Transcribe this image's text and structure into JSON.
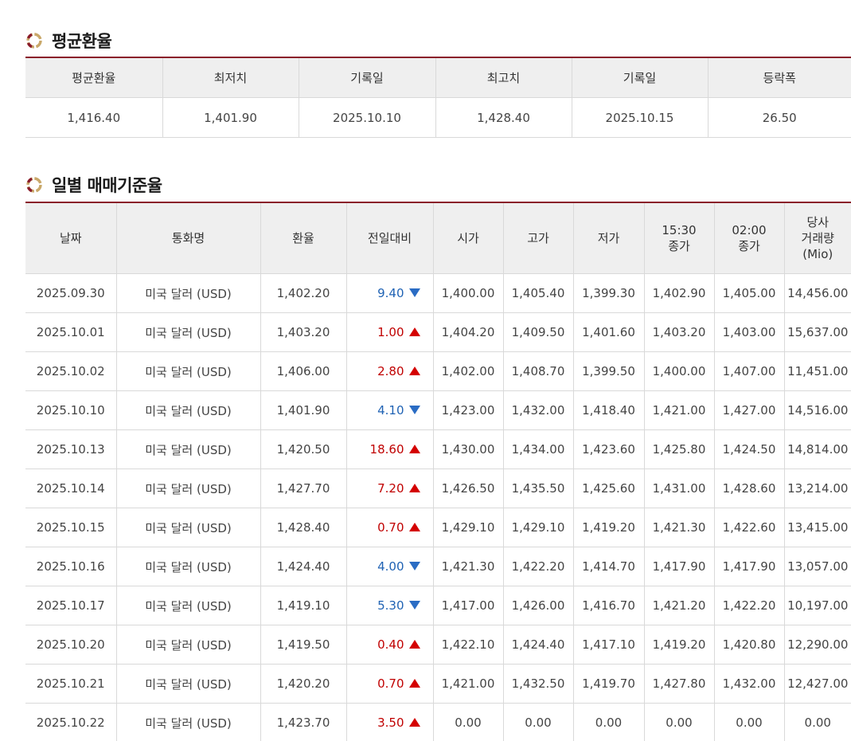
{
  "avg_section": {
    "title": "평균환율",
    "headers": [
      "평균환율",
      "최저치",
      "기록일",
      "최고치",
      "기록일",
      "등락폭"
    ],
    "values": [
      "1,416.40",
      "1,401.90",
      "2025.10.10",
      "1,428.40",
      "2025.10.15",
      "26.50"
    ]
  },
  "daily_section": {
    "title": "일별 매매기준율",
    "headers": [
      "날짜",
      "통화명",
      "환율",
      "전일대비",
      "시가",
      "고가",
      "저가",
      "15:30\n종가",
      "02:00\n종가",
      "당사\n거래량\n(Mio)"
    ],
    "rows": [
      {
        "date": "2025.09.30",
        "currency": "미국 달러 (USD)",
        "rate": "1,402.20",
        "change": "9.40",
        "dir": "down",
        "open": "1,400.00",
        "high": "1,405.40",
        "low": "1,399.30",
        "close1530": "1,402.90",
        "close0200": "1,405.00",
        "volume": "14,456.00"
      },
      {
        "date": "2025.10.01",
        "currency": "미국 달러 (USD)",
        "rate": "1,403.20",
        "change": "1.00",
        "dir": "up",
        "open": "1,404.20",
        "high": "1,409.50",
        "low": "1,401.60",
        "close1530": "1,403.20",
        "close0200": "1,403.00",
        "volume": "15,637.00"
      },
      {
        "date": "2025.10.02",
        "currency": "미국 달러 (USD)",
        "rate": "1,406.00",
        "change": "2.80",
        "dir": "up",
        "open": "1,402.00",
        "high": "1,408.70",
        "low": "1,399.50",
        "close1530": "1,400.00",
        "close0200": "1,407.00",
        "volume": "11,451.00"
      },
      {
        "date": "2025.10.10",
        "currency": "미국 달러 (USD)",
        "rate": "1,401.90",
        "change": "4.10",
        "dir": "down",
        "open": "1,423.00",
        "high": "1,432.00",
        "low": "1,418.40",
        "close1530": "1,421.00",
        "close0200": "1,427.00",
        "volume": "14,516.00"
      },
      {
        "date": "2025.10.13",
        "currency": "미국 달러 (USD)",
        "rate": "1,420.50",
        "change": "18.60",
        "dir": "up",
        "open": "1,430.00",
        "high": "1,434.00",
        "low": "1,423.60",
        "close1530": "1,425.80",
        "close0200": "1,424.50",
        "volume": "14,814.00"
      },
      {
        "date": "2025.10.14",
        "currency": "미국 달러 (USD)",
        "rate": "1,427.70",
        "change": "7.20",
        "dir": "up",
        "open": "1,426.50",
        "high": "1,435.50",
        "low": "1,425.60",
        "close1530": "1,431.00",
        "close0200": "1,428.60",
        "volume": "13,214.00"
      },
      {
        "date": "2025.10.15",
        "currency": "미국 달러 (USD)",
        "rate": "1,428.40",
        "change": "0.70",
        "dir": "up",
        "open": "1,429.10",
        "high": "1,429.10",
        "low": "1,419.20",
        "close1530": "1,421.30",
        "close0200": "1,422.60",
        "volume": "13,415.00"
      },
      {
        "date": "2025.10.16",
        "currency": "미국 달러 (USD)",
        "rate": "1,424.40",
        "change": "4.00",
        "dir": "down",
        "open": "1,421.30",
        "high": "1,422.20",
        "low": "1,414.70",
        "close1530": "1,417.90",
        "close0200": "1,417.90",
        "volume": "13,057.00"
      },
      {
        "date": "2025.10.17",
        "currency": "미국 달러 (USD)",
        "rate": "1,419.10",
        "change": "5.30",
        "dir": "down",
        "open": "1,417.00",
        "high": "1,426.00",
        "low": "1,416.70",
        "close1530": "1,421.20",
        "close0200": "1,422.20",
        "volume": "10,197.00"
      },
      {
        "date": "2025.10.20",
        "currency": "미국 달러 (USD)",
        "rate": "1,419.50",
        "change": "0.40",
        "dir": "up",
        "open": "1,422.10",
        "high": "1,424.40",
        "low": "1,417.10",
        "close1530": "1,419.20",
        "close0200": "1,420.80",
        "volume": "12,290.00"
      },
      {
        "date": "2025.10.21",
        "currency": "미국 달러 (USD)",
        "rate": "1,420.20",
        "change": "0.70",
        "dir": "up",
        "open": "1,421.00",
        "high": "1,432.50",
        "low": "1,419.70",
        "close1530": "1,427.80",
        "close0200": "1,432.00",
        "volume": "12,427.00"
      },
      {
        "date": "2025.10.22",
        "currency": "미국 달러 (USD)",
        "rate": "1,423.70",
        "change": "3.50",
        "dir": "up",
        "open": "0.00",
        "high": "0.00",
        "low": "0.00",
        "close1530": "0.00",
        "close0200": "0.00",
        "volume": "0.00"
      }
    ]
  },
  "colors": {
    "accent": "#8a1c2a",
    "up": "#c00000",
    "down": "#1f62b4",
    "header_bg": "#efefef",
    "icon_gold": "#c9a86a"
  },
  "icons": {
    "section_icon": "ring-icon",
    "up": "triangle-up-icon",
    "down": "triangle-down-icon"
  }
}
